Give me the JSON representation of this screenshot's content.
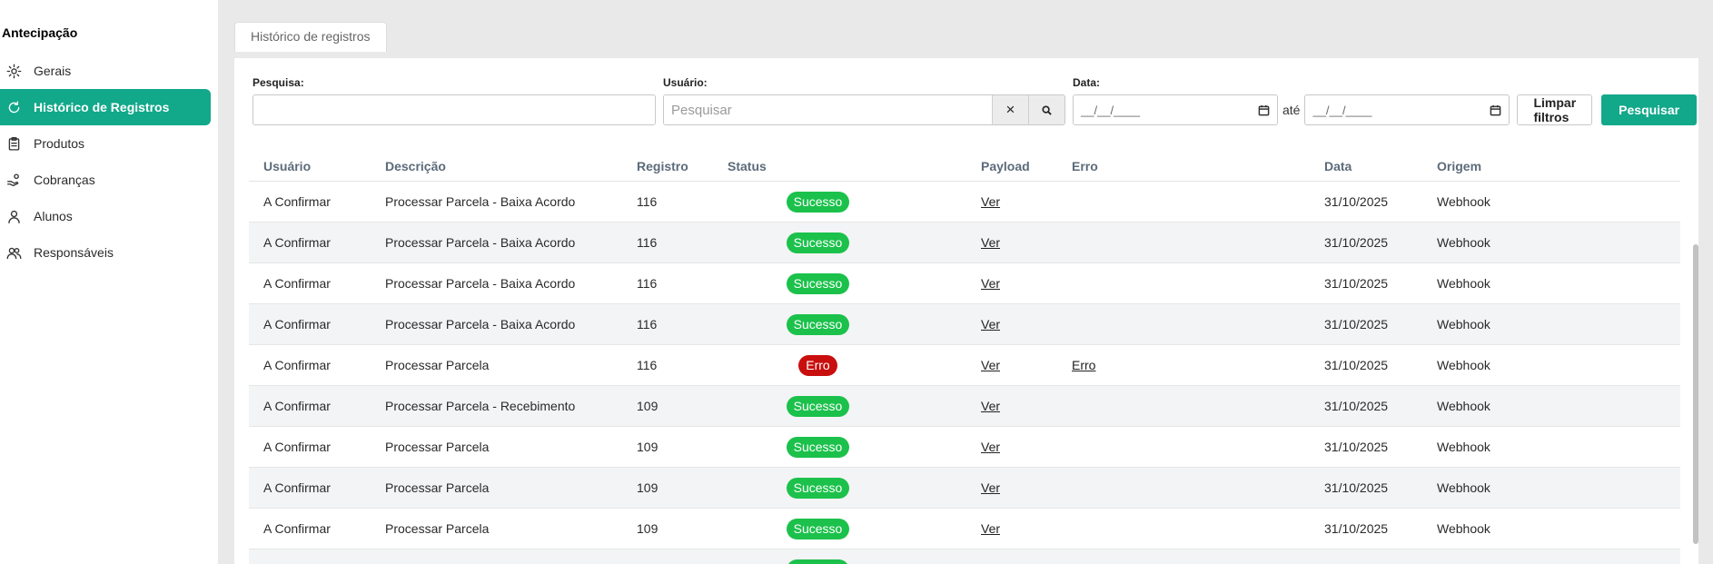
{
  "sidebar": {
    "title": "Antecipação",
    "items": [
      {
        "label": "Gerais",
        "icon": "gear-icon",
        "active": false
      },
      {
        "label": "Histórico de Registros",
        "icon": "refresh-icon",
        "active": true
      },
      {
        "label": "Produtos",
        "icon": "clipboard-icon",
        "active": false
      },
      {
        "label": "Cobranças",
        "icon": "hand-coins-icon",
        "active": false
      },
      {
        "label": "Alunos",
        "icon": "user-icon",
        "active": false
      },
      {
        "label": "Responsáveis",
        "icon": "users-icon",
        "active": false
      }
    ]
  },
  "tab": {
    "label": "Histórico de registros"
  },
  "filters": {
    "search_label": "Pesquisa:",
    "search_value": "",
    "user_label": "Usuário:",
    "user_placeholder": "Pesquisar",
    "clear_icon": "×",
    "date_label": "Data:",
    "date_from": "__/__/____",
    "date_sep": "até",
    "date_to": "__/__/____",
    "clear_button": "Limpar filtros",
    "search_button": "Pesquisar"
  },
  "table": {
    "headers": {
      "user": "Usuário",
      "desc": "Descrição",
      "reg": "Registro",
      "status": "Status",
      "payload": "Payload",
      "error": "Erro",
      "date": "Data",
      "origin": "Origem"
    },
    "rows": [
      {
        "user": "A Confirmar",
        "desc": "Processar Parcela - Baixa Acordo",
        "reg": "116",
        "status": "Sucesso",
        "payload": "Ver",
        "error": "",
        "date": "31/10/2025",
        "origin": "Webhook"
      },
      {
        "user": "A Confirmar",
        "desc": "Processar Parcela - Baixa Acordo",
        "reg": "116",
        "status": "Sucesso",
        "payload": "Ver",
        "error": "",
        "date": "31/10/2025",
        "origin": "Webhook"
      },
      {
        "user": "A Confirmar",
        "desc": "Processar Parcela - Baixa Acordo",
        "reg": "116",
        "status": "Sucesso",
        "payload": "Ver",
        "error": "",
        "date": "31/10/2025",
        "origin": "Webhook"
      },
      {
        "user": "A Confirmar",
        "desc": "Processar Parcela - Baixa Acordo",
        "reg": "116",
        "status": "Sucesso",
        "payload": "Ver",
        "error": "",
        "date": "31/10/2025",
        "origin": "Webhook"
      },
      {
        "user": "A Confirmar",
        "desc": "Processar Parcela",
        "reg": "116",
        "status": "Erro",
        "payload": "Ver",
        "error": "Erro",
        "date": "31/10/2025",
        "origin": "Webhook"
      },
      {
        "user": "A Confirmar",
        "desc": "Processar Parcela - Recebimento",
        "reg": "109",
        "status": "Sucesso",
        "payload": "Ver",
        "error": "",
        "date": "31/10/2025",
        "origin": "Webhook"
      },
      {
        "user": "A Confirmar",
        "desc": "Processar Parcela",
        "reg": "109",
        "status": "Sucesso",
        "payload": "Ver",
        "error": "",
        "date": "31/10/2025",
        "origin": "Webhook"
      },
      {
        "user": "A Confirmar",
        "desc": "Processar Parcela",
        "reg": "109",
        "status": "Sucesso",
        "payload": "Ver",
        "error": "",
        "date": "31/10/2025",
        "origin": "Webhook"
      },
      {
        "user": "A Confirmar",
        "desc": "Processar Parcela",
        "reg": "109",
        "status": "Sucesso",
        "payload": "Ver",
        "error": "",
        "date": "31/10/2025",
        "origin": "Webhook"
      },
      {
        "user": "",
        "desc": "",
        "reg": "",
        "status": "Sucesso",
        "payload": "",
        "error": "",
        "date": "",
        "origin": ""
      }
    ]
  },
  "colors": {
    "accent": "#12a88a",
    "success": "#1bc14b",
    "error": "#c90e0e"
  }
}
